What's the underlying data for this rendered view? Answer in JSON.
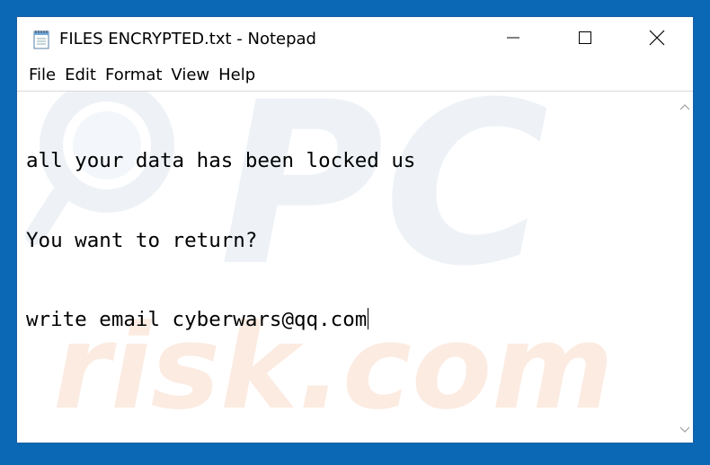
{
  "window": {
    "title": "FILES ENCRYPTED.txt - Notepad",
    "icon": "notepad-icon",
    "controls": {
      "minimize_icon": "minimize-icon",
      "maximize_icon": "maximize-icon",
      "close_icon": "close-icon"
    }
  },
  "menu": {
    "items": [
      "File",
      "Edit",
      "Format",
      "View",
      "Help"
    ]
  },
  "editor": {
    "lines": [
      "all your data has been locked us",
      "You want to return?",
      "write email cyberwars@qq.com"
    ]
  },
  "watermark": {
    "top": "PC",
    "bottom": "risk.com"
  },
  "colors": {
    "desktop": "#0a68b5",
    "window_border": "#1c5fa3",
    "text": "#000000",
    "watermark": "#e8eef5",
    "watermark_accent": "#fbe3d6"
  }
}
